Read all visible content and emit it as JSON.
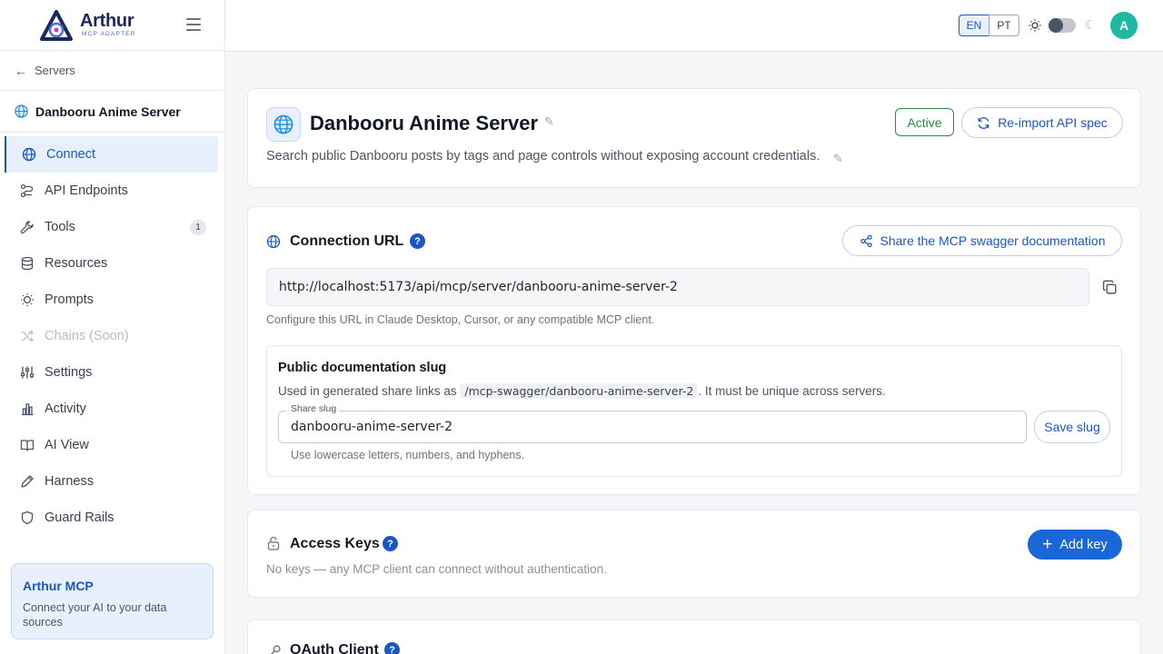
{
  "brand": {
    "name": "Arthur",
    "subtitle": "MCP ADAPTER"
  },
  "sidebar": {
    "back_label": "Servers",
    "server_name": "Danbooru Anime Server",
    "items": [
      {
        "label": "Connect",
        "icon": "globe-icon",
        "active": true
      },
      {
        "label": "API Endpoints",
        "icon": "route-icon"
      },
      {
        "label": "Tools",
        "icon": "wrench-icon",
        "badge": "1"
      },
      {
        "label": "Resources",
        "icon": "database-icon"
      },
      {
        "label": "Prompts",
        "icon": "lightbulb-icon"
      },
      {
        "label": "Chains (Soon)",
        "icon": "shuffle-icon",
        "disabled": true
      },
      {
        "label": "Settings",
        "icon": "sliders-icon"
      },
      {
        "label": "Activity",
        "icon": "bar-chart-icon"
      },
      {
        "label": "AI View",
        "icon": "book-icon"
      },
      {
        "label": "Harness",
        "icon": "pen-icon"
      },
      {
        "label": "Guard Rails",
        "icon": "shield-icon"
      }
    ],
    "promo": {
      "title": "Arthur MCP",
      "text": "Connect your AI to your data sources"
    }
  },
  "topbar": {
    "lang_en": "EN",
    "lang_pt": "PT",
    "avatar_initial": "A"
  },
  "server": {
    "title": "Danbooru Anime Server",
    "description": "Search public Danbooru posts by tags and page controls without exposing account credentials.",
    "status": "Active",
    "reimport_label": "Re-import API spec"
  },
  "connection": {
    "title": "Connection URL",
    "share_label": "Share the MCP swagger documentation",
    "url": "http://localhost:5173/api/mcp/server/danbooru-anime-server-2",
    "hint": "Configure this URL in Claude Desktop, Cursor, or any compatible MCP client.",
    "slug": {
      "title": "Public documentation slug",
      "desc_before": "Used in generated share links as",
      "path": "/mcp-swagger/danbooru-anime-server-2",
      "desc_after": ". It must be unique across servers.",
      "field_label": "Share slug",
      "value": "danbooru-anime-server-2",
      "save_label": "Save slug",
      "hint": "Use lowercase letters, numbers, and hyphens."
    }
  },
  "access_keys": {
    "title": "Access Keys",
    "empty": "No keys — any MCP client can connect without authentication.",
    "add_label": "Add key"
  },
  "oauth": {
    "title": "OAuth Client"
  },
  "colors": {
    "accent": "#1a56c8",
    "active_status": "#2e8b3e",
    "avatar": "#1fb8a3"
  }
}
